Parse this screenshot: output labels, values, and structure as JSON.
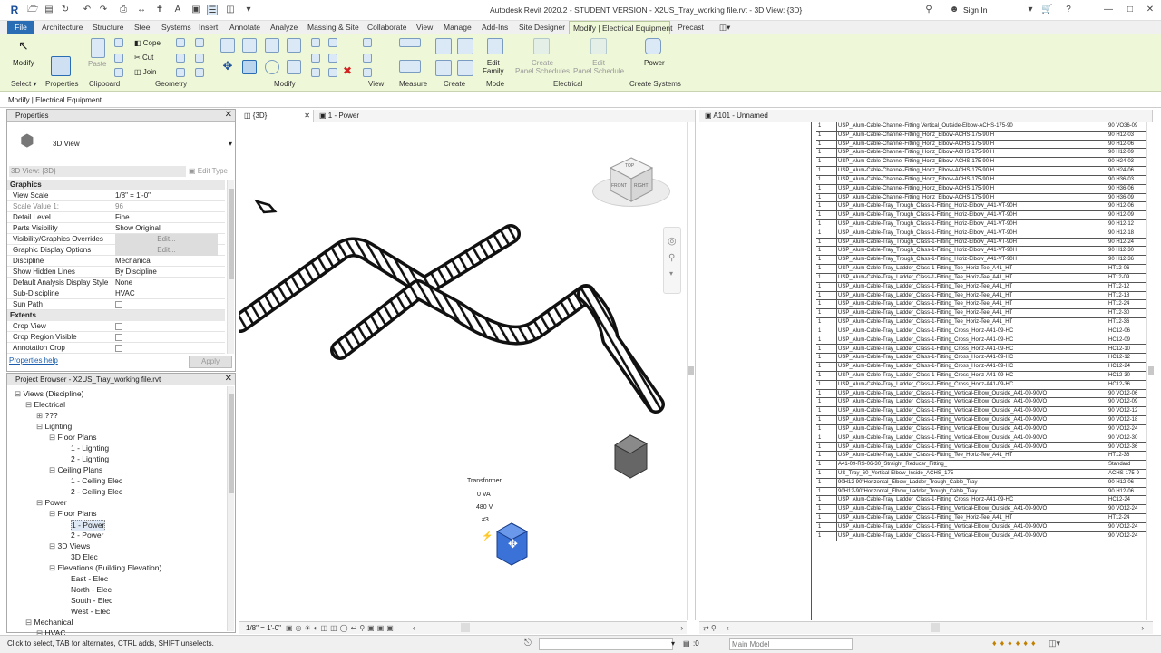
{
  "window": {
    "title": "Autodesk Revit 2020.2 - STUDENT VERSION - X2US_Tray_working file.rvt - 3D View: {3D}",
    "sign_in": "Sign In"
  },
  "tabs": [
    "File",
    "Architecture",
    "Structure",
    "Steel",
    "Systems",
    "Insert",
    "Annotate",
    "Analyze",
    "Massing & Site",
    "Collaborate",
    "View",
    "Manage",
    "Add-Ins",
    "Site Designer",
    "Modify | Electrical Equipment",
    "Precast"
  ],
  "ribbon": {
    "modify": "Modify",
    "paste": "Paste",
    "cope": "Cope",
    "cut": "Cut",
    "join": "Join",
    "edit_family": "Edit\nFamily",
    "create_panel_schedules": "Create\nPanel Schedules",
    "edit_panel_schedule": "Edit\nPanel Schedule",
    "power": "Power",
    "panels": [
      "Select",
      "Properties",
      "Clipboard",
      "Geometry",
      "Modify",
      "View",
      "Measure",
      "Create",
      "Mode",
      "Electrical",
      "Create Systems"
    ]
  },
  "context_bar": "Modify | Electrical Equipment",
  "properties": {
    "title": "Properties",
    "type_name": "3D View",
    "selector": "3D View: {3D}",
    "edit_type": "Edit Type",
    "groups": {
      "graphics": "Graphics",
      "extents": "Extents"
    },
    "rows": [
      {
        "k": "View Scale",
        "v": "1/8\" = 1'-0\""
      },
      {
        "k": "Scale Value    1:",
        "v": "96"
      },
      {
        "k": "Detail Level",
        "v": "Fine"
      },
      {
        "k": "Parts Visibility",
        "v": "Show Original"
      },
      {
        "k": "Visibility/Graphics Overrides",
        "v": "Edit..."
      },
      {
        "k": "Graphic Display Options",
        "v": "Edit..."
      },
      {
        "k": "Discipline",
        "v": "Mechanical"
      },
      {
        "k": "Show Hidden Lines",
        "v": "By Discipline"
      },
      {
        "k": "Default Analysis Display Style",
        "v": "None"
      },
      {
        "k": "Sub-Discipline",
        "v": "HVAC"
      },
      {
        "k": "Sun Path",
        "v": ""
      }
    ],
    "extents": [
      {
        "k": "Crop View"
      },
      {
        "k": "Crop Region Visible"
      },
      {
        "k": "Annotation Crop"
      }
    ],
    "help": "Properties help",
    "apply": "Apply"
  },
  "browser": {
    "title": "Project Browser - X2US_Tray_working file.rvt",
    "nodes": [
      {
        "t": "Views (Discipline)",
        "lvl": 0
      },
      {
        "t": "Electrical",
        "lvl": 1
      },
      {
        "t": "???",
        "lvl": 2
      },
      {
        "t": "Lighting",
        "lvl": 2
      },
      {
        "t": "Floor Plans",
        "lvl": 3
      },
      {
        "t": "1 - Lighting",
        "lvl": 4
      },
      {
        "t": "2 - Lighting",
        "lvl": 4
      },
      {
        "t": "Ceiling Plans",
        "lvl": 3
      },
      {
        "t": "1 - Ceiling Elec",
        "lvl": 4
      },
      {
        "t": "2 - Ceiling Elec",
        "lvl": 4
      },
      {
        "t": "Power",
        "lvl": 2
      },
      {
        "t": "Floor Plans",
        "lvl": 3
      },
      {
        "t": "1 - Power",
        "lvl": 4
      },
      {
        "t": "2 - Power",
        "lvl": 4
      },
      {
        "t": "3D Views",
        "lvl": 3
      },
      {
        "t": "3D Elec",
        "lvl": 4
      },
      {
        "t": "Elevations (Building Elevation)",
        "lvl": 3
      },
      {
        "t": "East - Elec",
        "lvl": 4
      },
      {
        "t": "North - Elec",
        "lvl": 4
      },
      {
        "t": "South - Elec",
        "lvl": 4
      },
      {
        "t": "West - Elec",
        "lvl": 4
      },
      {
        "t": "Mechanical",
        "lvl": 1
      },
      {
        "t": "HVAC",
        "lvl": 2
      }
    ]
  },
  "view_tabs": {
    "v3d": "{3D}",
    "power": "1 - Power",
    "sheet": "A101 - Unnamed"
  },
  "view3d": {
    "tag": {
      "name": "Transformer",
      "va": "0 VA",
      "v": "480 V",
      "num": "#3"
    },
    "scale": "1/8\" = 1'-0\"",
    "viewcube": {
      "top": "TOP",
      "front": "FRONT",
      "right": "RIGHT"
    }
  },
  "schedule": [
    [
      "1",
      "USP_Alum-Cable-Channel-Fitting Vertical_Outside-Elbow-ACHS-175-90",
      "90 VO36-09"
    ],
    [
      "1",
      "USP_Alum-Cable-Channel-Fitting_Horiz_Elbow-ACHS-175-90 H",
      "90 H12-03"
    ],
    [
      "1",
      "USP_Alum-Cable-Channel-Fitting_Horiz_Elbow-ACHS-175-90 H",
      "90 H12-06"
    ],
    [
      "1",
      "USP_Alum-Cable-Channel-Fitting_Horiz_Elbow-ACHS-175-90 H",
      "90 H12-09"
    ],
    [
      "1",
      "USP_Alum-Cable-Channel-Fitting_Horiz_Elbow-ACHS-175-90 H",
      "90 H24-03"
    ],
    [
      "1",
      "USP_Alum-Cable-Channel-Fitting_Horiz_Elbow-ACHS-175-90 H",
      "90 H24-06"
    ],
    [
      "1",
      "USP_Alum-Cable-Channel-Fitting_Horiz_Elbow-ACHS-175-90 H",
      "90 H36-03"
    ],
    [
      "1",
      "USP_Alum-Cable-Channel-Fitting_Horiz_Elbow-ACHS-175-90 H",
      "90 H36-06"
    ],
    [
      "1",
      "USP_Alum-Cable-Channel-Fitting_Horiz_Elbow-ACHS-175-90 H",
      "90 H36-09"
    ],
    [
      "1",
      "USP_Alum-Cable-Tray_Trough_Class-1-Fitting_Horiz-Elbow_A41-VT-90H",
      "90 H12-06"
    ],
    [
      "1",
      "USP_Alum-Cable-Tray_Trough_Class-1-Fitting_Horiz-Elbow_A41-VT-90H",
      "90 H12-09"
    ],
    [
      "1",
      "USP_Alum-Cable-Tray_Trough_Class-1-Fitting_Horiz-Elbow_A41-VT-90H",
      "90 H12-12"
    ],
    [
      "1",
      "USP_Alum-Cable-Tray_Trough_Class-1-Fitting_Horiz-Elbow_A41-VT-90H",
      "90 H12-18"
    ],
    [
      "1",
      "USP_Alum-Cable-Tray_Trough_Class-1-Fitting_Horiz-Elbow_A41-VT-90H",
      "90 H12-24"
    ],
    [
      "1",
      "USP_Alum-Cable-Tray_Trough_Class-1-Fitting_Horiz-Elbow_A41-VT-90H",
      "90 H12-30"
    ],
    [
      "1",
      "USP_Alum-Cable-Tray_Trough_Class-1-Fitting_Horiz-Elbow_A41-VT-90H",
      "90 H12-36"
    ],
    [
      "1",
      "USP_Alum-Cable-Tray_Ladder_Class-1-Fitting_Tee_Horiz-Tee_A41_HT",
      "HT12-06"
    ],
    [
      "1",
      "USP_Alum-Cable-Tray_Ladder_Class-1-Fitting_Tee_Horiz-Tee_A41_HT",
      "HT12-09"
    ],
    [
      "1",
      "USP_Alum-Cable-Tray_Ladder_Class-1-Fitting_Tee_Horiz-Tee_A41_HT",
      "HT12-12"
    ],
    [
      "1",
      "USP_Alum-Cable-Tray_Ladder_Class-1-Fitting_Tee_Horiz-Tee_A41_HT",
      "HT12-18"
    ],
    [
      "1",
      "USP_Alum-Cable-Tray_Ladder_Class-1-Fitting_Tee_Horiz-Tee_A41_HT",
      "HT12-24"
    ],
    [
      "1",
      "USP_Alum-Cable-Tray_Ladder_Class-1-Fitting_Tee_Horiz-Tee_A41_HT",
      "HT12-30"
    ],
    [
      "1",
      "USP_Alum-Cable-Tray_Ladder_Class-1-Fitting_Tee_Horiz-Tee_A41_HT",
      "HT12-36"
    ],
    [
      "1",
      "USP_Alum-Cable-Tray_Ladder_Class-1-Fitting_Cross_Horiz-A41-09-HC",
      "HC12-06"
    ],
    [
      "1",
      "USP_Alum-Cable-Tray_Ladder_Class-1-Fitting_Cross_Horiz-A41-09-HC",
      "HC12-09"
    ],
    [
      "1",
      "USP_Alum-Cable-Tray_Ladder_Class-1-Fitting_Cross_Horiz-A41-09-HC",
      "HC12-10"
    ],
    [
      "1",
      "USP_Alum-Cable-Tray_Ladder_Class-1-Fitting_Cross_Horiz-A41-09-HC",
      "HC12-12"
    ],
    [
      "1",
      "USP_Alum-Cable-Tray_Ladder_Class-1-Fitting_Cross_Horiz-A41-09-HC",
      "HC12-24"
    ],
    [
      "1",
      "USP_Alum-Cable-Tray_Ladder_Class-1-Fitting_Cross_Horiz-A41-09-HC",
      "HC12-30"
    ],
    [
      "1",
      "USP_Alum-Cable-Tray_Ladder_Class-1-Fitting_Cross_Horiz-A41-09-HC",
      "HC12-36"
    ],
    [
      "1",
      "USP_Alum-Cable-Tray_Ladder_Class-1-Fitting_Vertical-Elbow_Outside_A41-09-90VO",
      "90 VO12-06"
    ],
    [
      "1",
      "USP_Alum-Cable-Tray_Ladder_Class-1-Fitting_Vertical-Elbow_Outside_A41-09-90VO",
      "90 VO12-09"
    ],
    [
      "1",
      "USP_Alum-Cable-Tray_Ladder_Class-1-Fitting_Vertical-Elbow_Outside_A41-09-90VO",
      "90 VO12-12"
    ],
    [
      "1",
      "USP_Alum-Cable-Tray_Ladder_Class-1-Fitting_Vertical-Elbow_Outside_A41-09-90VO",
      "90 VO12-18"
    ],
    [
      "1",
      "USP_Alum-Cable-Tray_Ladder_Class-1-Fitting_Vertical-Elbow_Outside_A41-09-90VO",
      "90 VO12-24"
    ],
    [
      "1",
      "USP_Alum-Cable-Tray_Ladder_Class-1-Fitting_Vertical-Elbow_Outside_A41-09-90VO",
      "90 VO12-30"
    ],
    [
      "1",
      "USP_Alum-Cable-Tray_Ladder_Class-1-Fitting_Vertical-Elbow_Outside_A41-09-90VO",
      "90 VO12-36"
    ],
    [
      "1",
      "USP_Alum-Cable-Tray_Ladder_Class-1-Fitting_Tee_Horiz-Tee_A41_HT",
      "HT12-36"
    ],
    [
      "1",
      "A41-09-RS-06-30_Straight_Reducer_Fitting_",
      "Standard"
    ],
    [
      "1",
      "US_Tray_60_Vertical Elbow_Inside_ACHS_175",
      "ACHS-175-9"
    ],
    [
      "1",
      "90H12-90\"Horizontal_Elbow_Ladder_Trough_Cable_Tray",
      "90 H12-06"
    ],
    [
      "1",
      "90H12-90\"Horizontal_Elbow_Ladder_Trough_Cable_Tray",
      "90 H12-06"
    ],
    [
      "1",
      "USP_Alum-Cable-Tray_Ladder_Class-1-Fitting_Cross_Horiz-A41-09-HC",
      "HC12-24"
    ],
    [
      "1",
      "USP_Alum-Cable-Tray_Ladder_Class-1-Fitting_Vertical-Elbow_Outside_A41-09-90VO",
      "90 VO12-24"
    ],
    [
      "1",
      "USP_Alum-Cable-Tray_Ladder_Class-1-Fitting_Tee_Horiz-Tee_A41_HT",
      "HT12-24"
    ],
    [
      "1",
      "USP_Alum-Cable-Tray_Ladder_Class-1-Fitting_Vertical-Elbow_Outside_A41-09-90VO",
      "90 VO12-24"
    ],
    [
      "1",
      "USP_Alum-Cable-Tray_Ladder_Class-1-Fitting_Vertical-Elbow_Outside_A41-09-90VO",
      "90 VO12-24"
    ]
  ],
  "status": {
    "msg": "Click to select, TAB for alternates, CTRL adds, SHIFT unselects.",
    "zero": ":0",
    "model": "Main Model"
  }
}
